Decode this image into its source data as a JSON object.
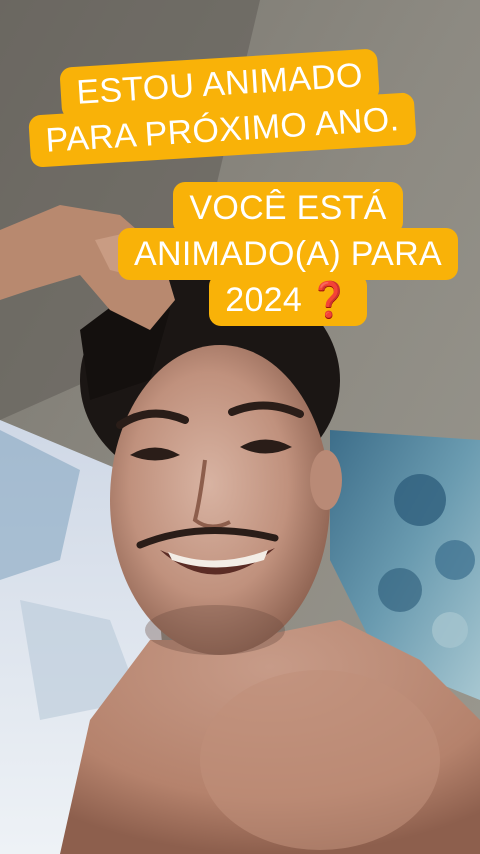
{
  "captions": {
    "top": {
      "line1": "ESTOU ANIMADO",
      "line2": "PARA PRÓXIMO ANO."
    },
    "bottom": {
      "line1": "VOCÊ ESTÁ",
      "line2": "ANIMADO(A) PARA",
      "line3": "2024",
      "emoji": "❓"
    }
  },
  "colors": {
    "caption_bg": "#f9b208",
    "caption_text": "#ffffff",
    "emoji": "#e1251b"
  }
}
